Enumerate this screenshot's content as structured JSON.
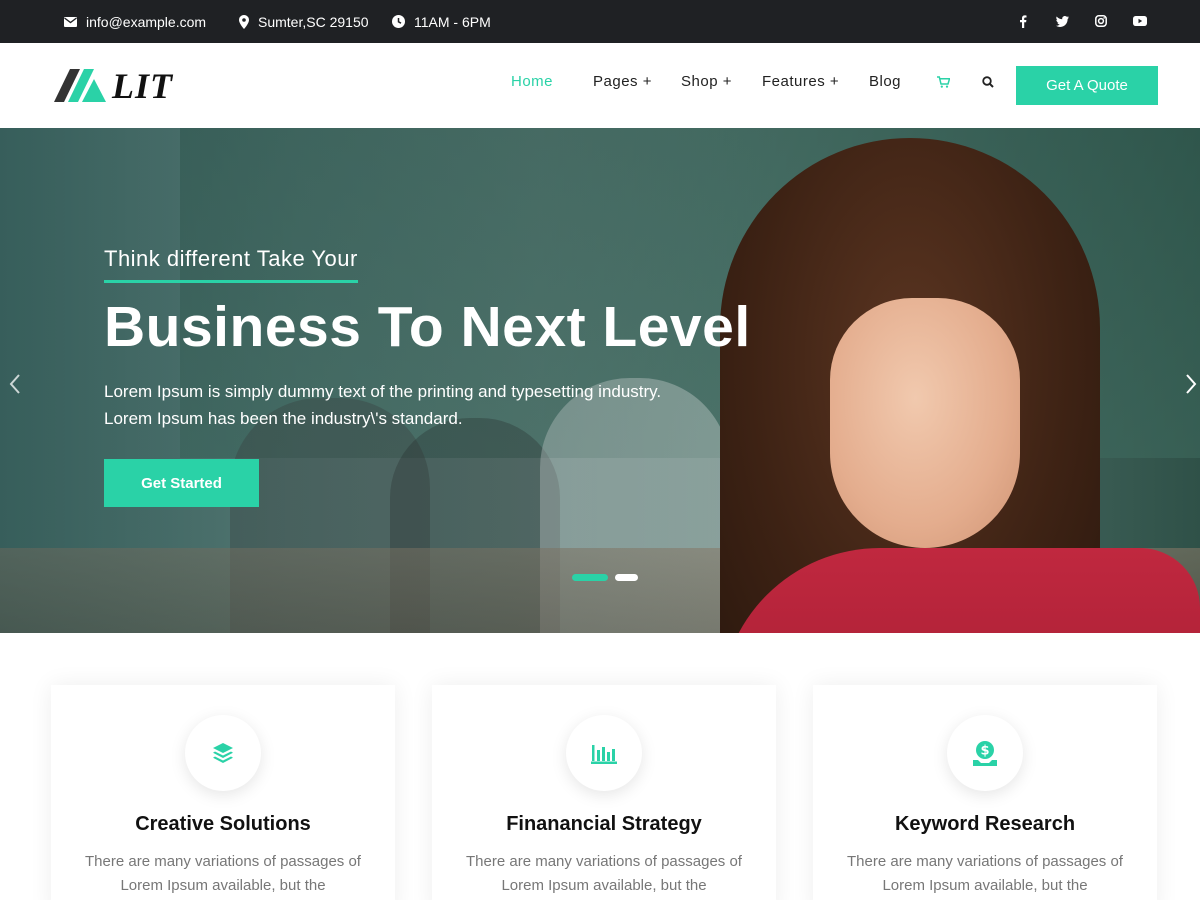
{
  "topbar": {
    "email": "info@example.com",
    "location": "Sumter,SC 29150",
    "hours": "11AM - 6PM",
    "social": [
      "facebook-icon",
      "twitter-icon",
      "instagram-icon",
      "youtube-icon"
    ]
  },
  "header": {
    "logo_text": "LIT",
    "nav": [
      {
        "label": "Home",
        "active": true
      },
      {
        "label": "Pages +"
      },
      {
        "label": "Shop +"
      },
      {
        "label": "Features +"
      },
      {
        "label": "Blog"
      }
    ],
    "icons": [
      "cart-icon",
      "search-icon"
    ],
    "quote_button": "Get A Quote"
  },
  "hero": {
    "subtitle": "Think different Take Your",
    "title": "Business To Next Level",
    "text": "Lorem Ipsum is simply dummy text of the printing and typesetting industry. Lorem Ipsum has been the industry\\'s standard.",
    "button": "Get Started",
    "slides": 2,
    "active_slide": 1
  },
  "cards": [
    {
      "icon": "layers-icon",
      "title": "Creative Solutions",
      "text": "There are many variations of passages of Lorem Ipsum available, but the"
    },
    {
      "icon": "bar-chart-icon",
      "title": "Finanancial Strategy",
      "text": "There are many variations of passages of Lorem Ipsum available, but the"
    },
    {
      "icon": "money-hand-icon",
      "title": "Keyword Research",
      "text": "There are many variations of passages of Lorem Ipsum available, but the"
    }
  ],
  "colors": {
    "accent": "#2ad2a7",
    "topbar": "#1f2124"
  }
}
